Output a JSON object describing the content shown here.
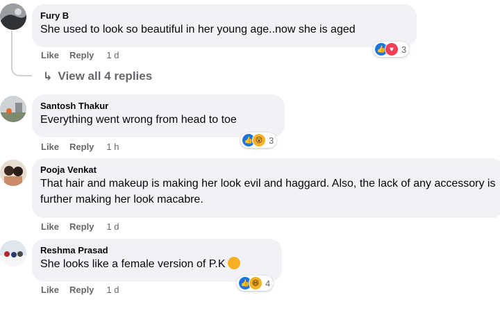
{
  "comments": [
    {
      "author": "Fury B",
      "text": "She used to look so beautiful in her young age..now she is aged",
      "like_label": "Like",
      "reply_label": "Reply",
      "time": "1 d",
      "reaction_count": "3",
      "reactions": [
        "like-icon",
        "love-icon"
      ]
    },
    {
      "author": "Santosh Thakur",
      "text": "Everything went wrong from head to toe",
      "like_label": "Like",
      "reply_label": "Reply",
      "time": "1 h",
      "reaction_count": "3",
      "reactions": [
        "like-icon",
        "wow-icon"
      ]
    },
    {
      "author": "Pooja Venkat",
      "text": "That hair and makeup is making her look evil and haggard. Also, the lack of any accessory is further making her look macabre.",
      "like_label": "Like",
      "reply_label": "Reply",
      "time": "1 d"
    },
    {
      "author": "Reshma Prasad",
      "text": "She looks like a female version of P.K",
      "like_label": "Like",
      "reply_label": "Reply",
      "time": "1 d",
      "reaction_count": "4",
      "reactions": [
        "like-icon",
        "haha-icon"
      ]
    }
  ],
  "view_replies_label": "View all 4 replies",
  "colors": {
    "bubble": "#f0f2f5",
    "meta_text": "#65676b",
    "like_blue": "#1b74e4",
    "love_red": "#f33e58",
    "haha_yellow": "#f7b125"
  }
}
